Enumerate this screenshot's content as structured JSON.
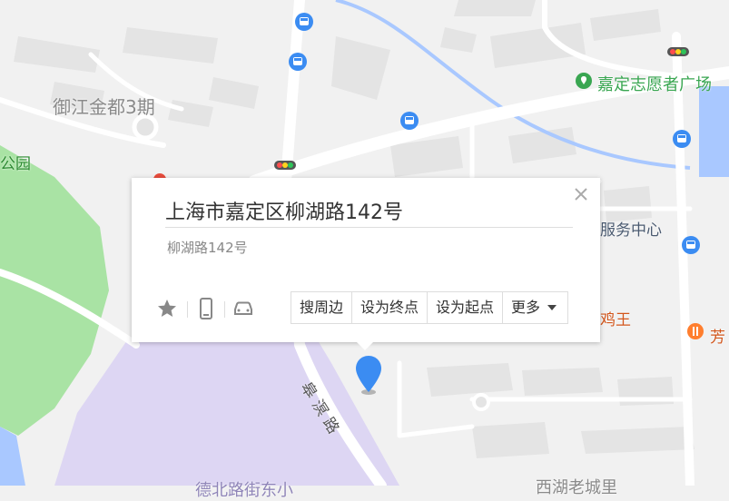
{
  "map": {
    "labels": {
      "yujiang": "御江金都3期",
      "park": "公园",
      "volunteer_square": "嘉定志愿者广场",
      "service_center": "服务中心",
      "chicken_king": "鸡王",
      "fang": "芳",
      "road_name": "皋溟路",
      "old_town": "西湖老城里",
      "bottom_area": "德北路街东小"
    },
    "colors": {
      "background": "#f1f1f1",
      "road": "#ffffff",
      "park": "#a9e3a4",
      "water": "#a9c8ff",
      "purple_zone": "#ddd6f3",
      "bus_stop": "#3b8cf2",
      "poi_green": "#39a651",
      "poi_orange": "#ff7e2e",
      "pin": "#3b8cf2"
    }
  },
  "popup": {
    "title": "上海市嘉定区柳湖路142号",
    "subtitle": "柳湖路142号",
    "actions": {
      "search_nearby": "搜周边",
      "set_destination": "设为终点",
      "set_origin": "设为起点",
      "more": "更多"
    },
    "icons": {
      "close": "close-icon",
      "favorite": "star-icon",
      "send_to_phone": "phone-icon",
      "car": "car-icon"
    }
  }
}
